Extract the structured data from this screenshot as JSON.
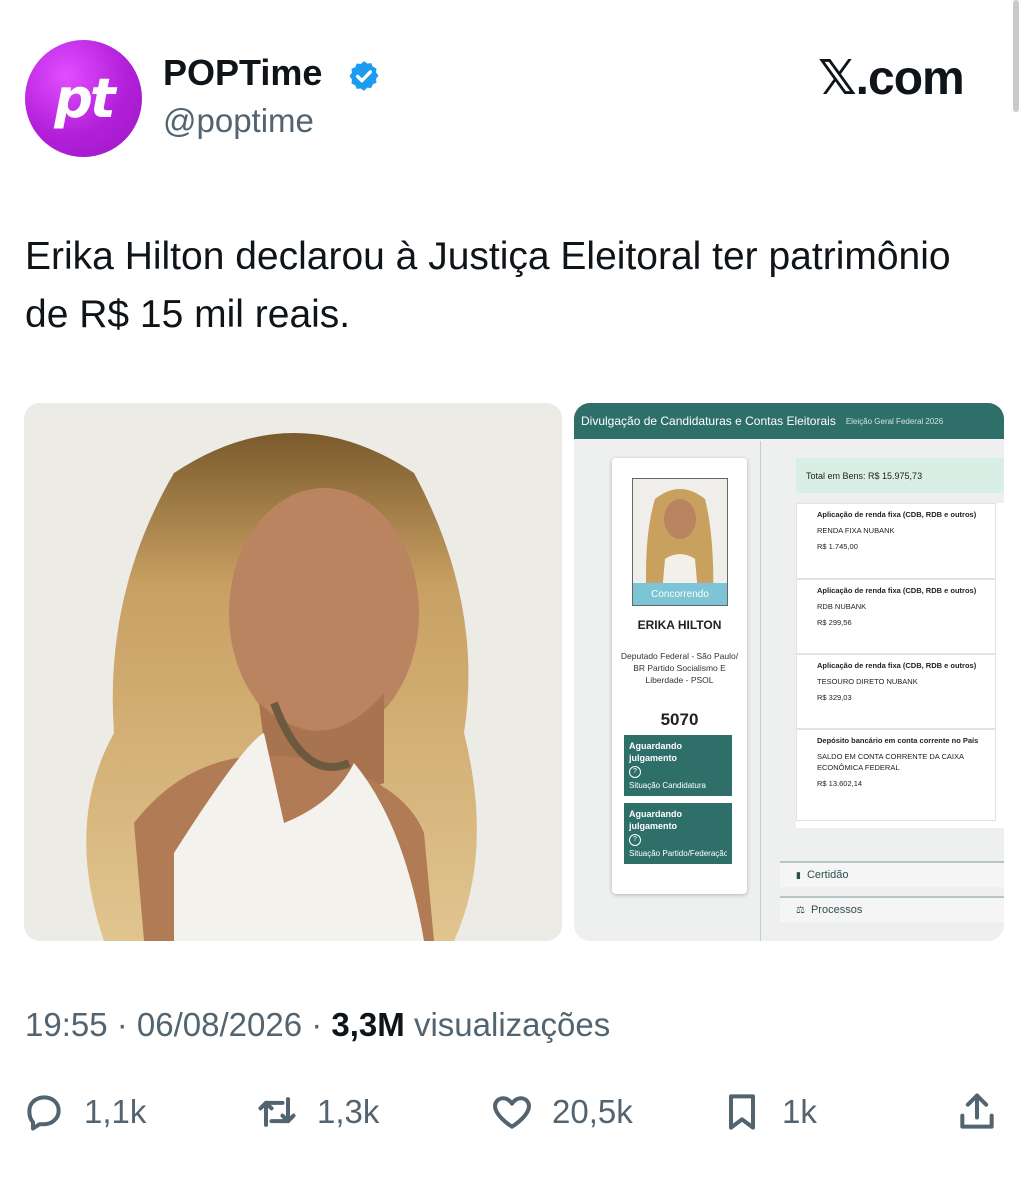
{
  "header": {
    "avatar_text": "pt",
    "display_name": "POPTime",
    "handle": "@poptime",
    "site_logo": "𝕏.com"
  },
  "tweet": {
    "text": "Erika Hilton declarou à Justiça Eleitoral ter patrimônio de R$ 15 mil reais."
  },
  "screenshot": {
    "header_title": "Divulgação de Candidaturas e Contas Eleitorais",
    "header_sub": "Eleição Geral Federal 2026",
    "badge": "Concorrendo",
    "candidate_name": "ERIKA HILTON",
    "candidate_desc": "Deputado Federal - São Paulo/ BR Partido Socialismo E Liberdade - PSOL",
    "candidate_number": "5070",
    "status": [
      {
        "title": "Aguardando julgamento",
        "label": "Situação Candidatura"
      },
      {
        "title": "Aguardando julgamento",
        "label": "Situação Partido/Federação/Coligação"
      }
    ],
    "total_label": "Total em Bens: R$ 15.975,73",
    "assets": [
      {
        "type": "Aplicação de renda fixa (CDB, RDB e outros)",
        "name": "RENDA FIXA NUBANK",
        "value": "R$ 1.745,00"
      },
      {
        "type": "Aplicação de renda fixa (CDB, RDB e outros)",
        "name": "RDB NUBANK",
        "value": "R$ 299,56"
      },
      {
        "type": "Aplicação de renda fixa (CDB, RDB e outros)",
        "name": "TESOURO DIRETO NUBANK",
        "value": "R$ 329,03"
      },
      {
        "type": "Depósito bancário em conta corrente no País",
        "name": "SALDO EM CONTA CORRENTE DA CAIXA ECONÔMICA FEDERAL",
        "value": "R$ 13.602,14"
      }
    ],
    "accordion": [
      "Certidão",
      "Processos"
    ]
  },
  "meta": {
    "time": "19:55 · 06/08/2026 · ",
    "views_count": "3,3M",
    "views_label": " visualizações"
  },
  "actions": {
    "replies": "1,1k",
    "reposts": "1,3k",
    "likes": "20,5k",
    "bookmarks": "1k"
  },
  "colors": {
    "avatar": "#b21fd9",
    "verified": "#1d9bf0",
    "panel_header": "#2f6f6a",
    "secondary_text": "#536471"
  }
}
